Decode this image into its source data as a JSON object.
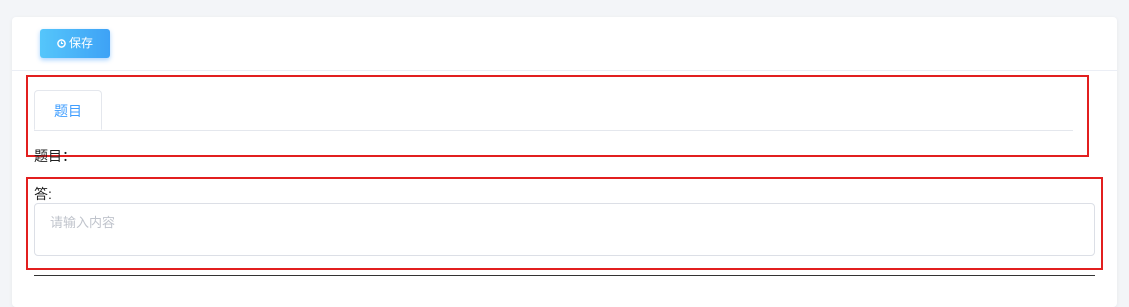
{
  "toolbar": {
    "save_label": "保存",
    "save_icon": "clock-icon"
  },
  "tabs": [
    {
      "label": "题目",
      "active": true
    }
  ],
  "form": {
    "question_label": "题目：",
    "answer_label": "答:",
    "answer_placeholder": "请输入内容",
    "answer_value": ""
  },
  "colors": {
    "accent": "#409eff",
    "highlight_border": "#e21f1f",
    "page_bg": "#f3f5f8"
  }
}
